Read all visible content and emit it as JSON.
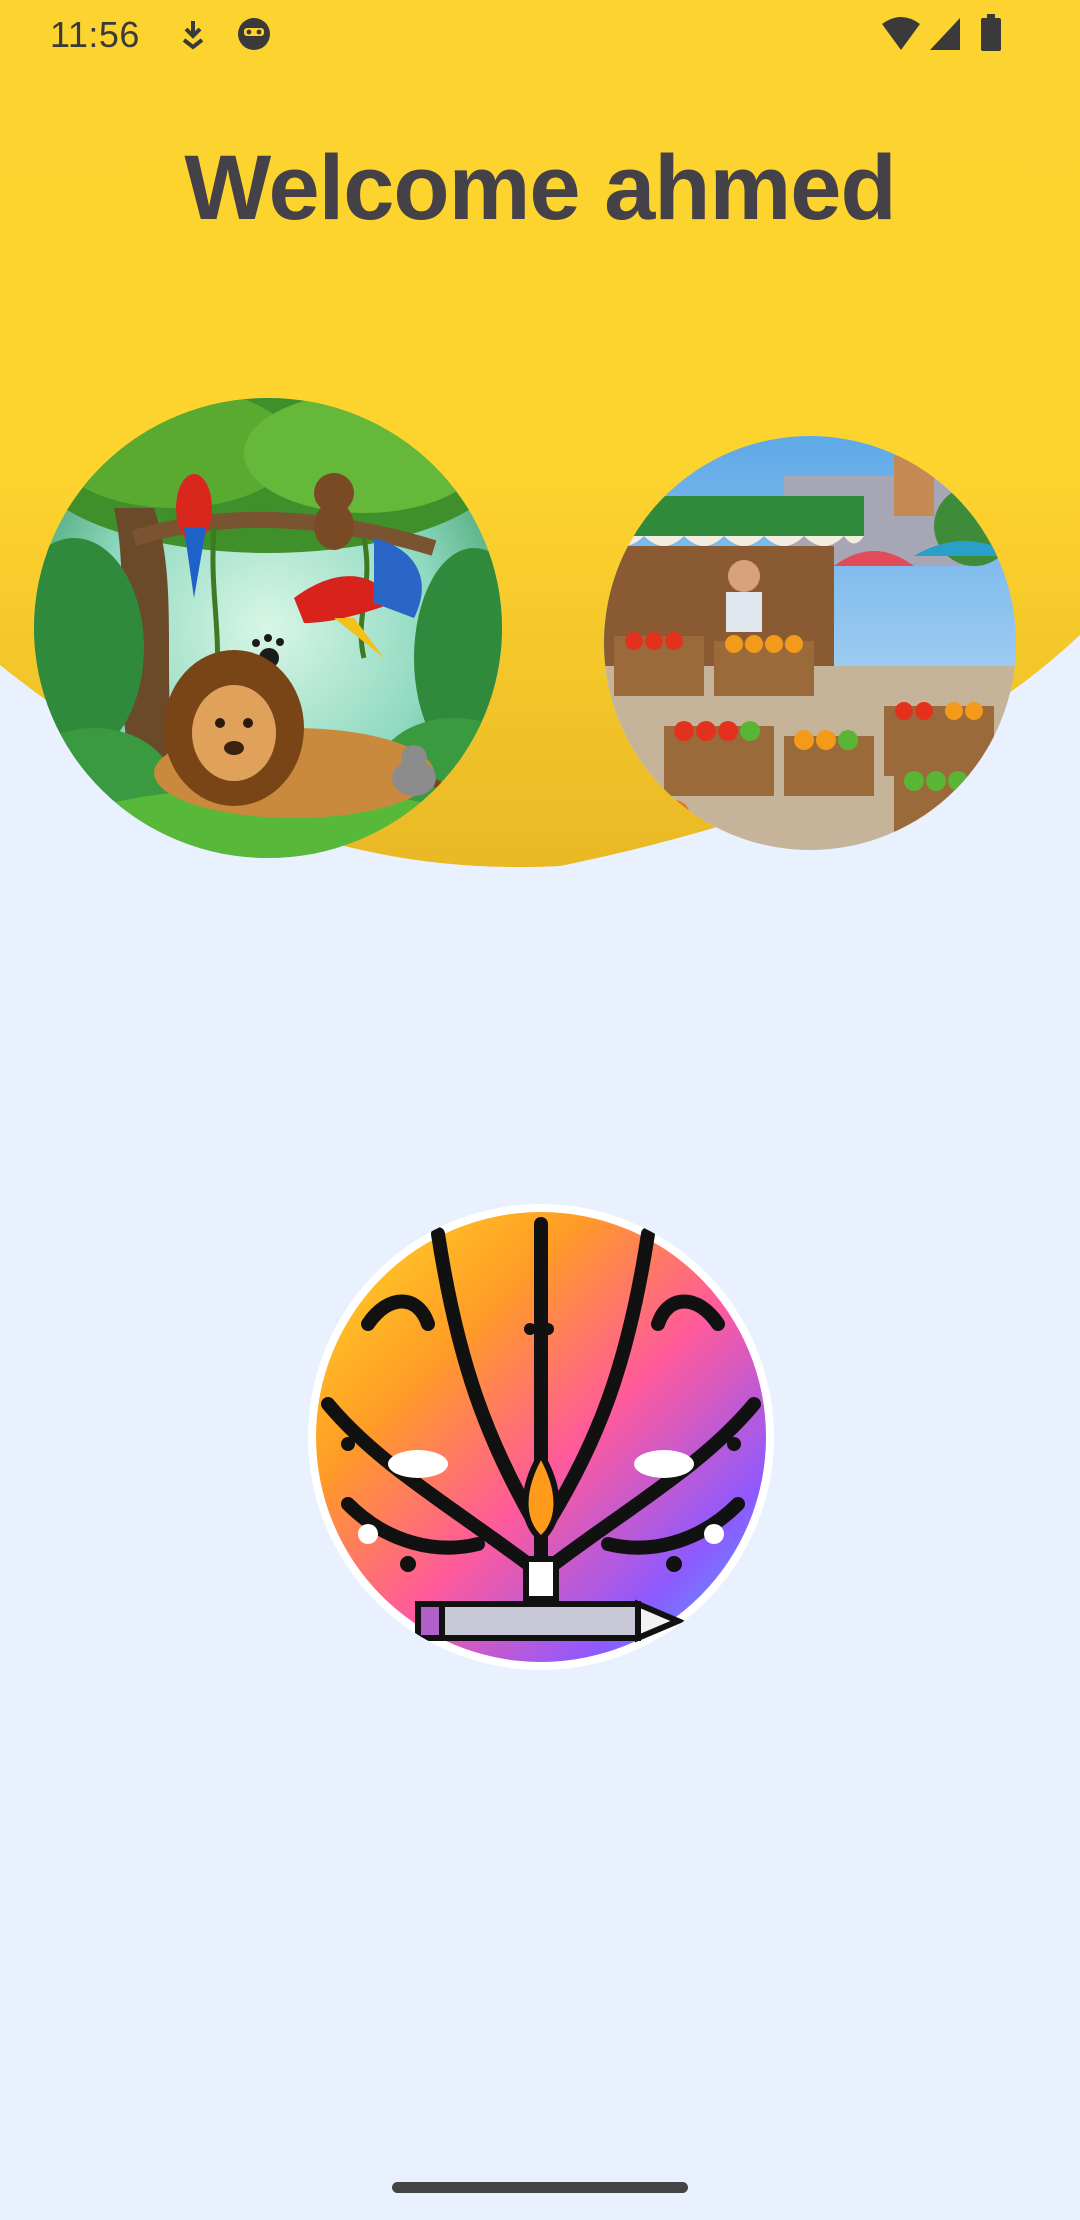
{
  "status_bar": {
    "time": "11:56",
    "left_icons": [
      "download-arrow-icon",
      "app-face-icon"
    ],
    "right_icons": [
      "wifi-icon",
      "cell-signal-icon",
      "battery-icon"
    ]
  },
  "header": {
    "title": "Welcome ahmed",
    "background_color": "#fdd32e"
  },
  "categories": [
    {
      "name": "jungle-animals-image",
      "icon": "jungle-lion-parrots-illustration"
    },
    {
      "name": "fruit-market-image",
      "icon": "market-stall-illustration"
    },
    {
      "name": "colorful-art-image",
      "icon": "colorful-pencil-tree-illustration"
    }
  ],
  "colors": {
    "page_background": "#e8f1fd",
    "header_yellow": "#fdd32e",
    "title_text": "#444149"
  }
}
